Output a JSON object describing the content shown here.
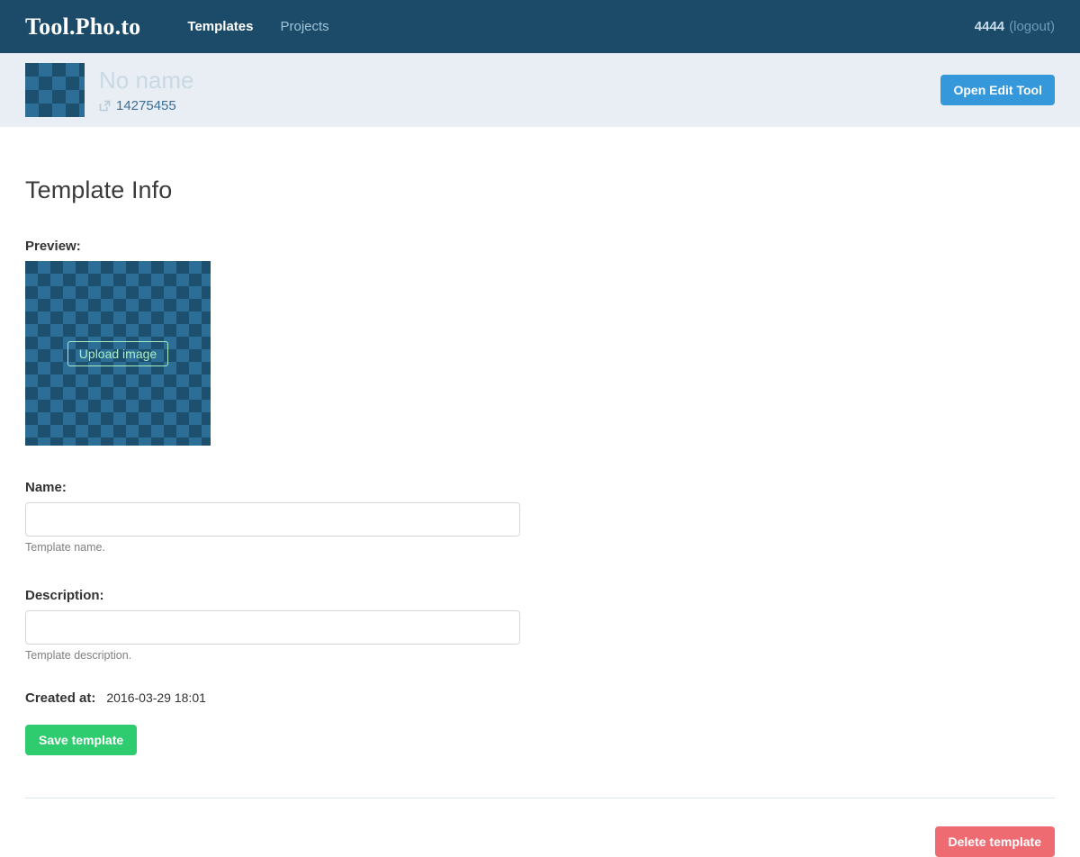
{
  "navbar": {
    "brand": "Tool.Pho.to",
    "links": [
      {
        "label": "Templates",
        "active": true
      },
      {
        "label": "Projects",
        "active": false
      }
    ],
    "user": "4444",
    "logout_label": "(logout)",
    "bg_color": "#1b4b68"
  },
  "subheader": {
    "thumbnail_icon": "checker-pattern-thumbnail",
    "title": "No name",
    "template_id": "14275455",
    "external_link_icon": "external-link-icon",
    "open_edit_label": "Open Edit Tool",
    "open_edit_color": "#3498db",
    "bg_color": "#e8eef4"
  },
  "main": {
    "page_title": "Template Info",
    "preview": {
      "label": "Preview:",
      "upload_label": "Upload image",
      "upload_border_color": "#a6eec6"
    },
    "name_field": {
      "label": "Name:",
      "value": "",
      "placeholder": "",
      "help": "Template name."
    },
    "description_field": {
      "label": "Description:",
      "value": "",
      "placeholder": "",
      "help": "Template description."
    },
    "created_at": {
      "label": "Created at:",
      "value": "2016-03-29 18:01"
    },
    "save_label": "Save template",
    "save_color": "#2ecc6f",
    "delete_label": "Delete template",
    "delete_color": "#ee6b72"
  }
}
